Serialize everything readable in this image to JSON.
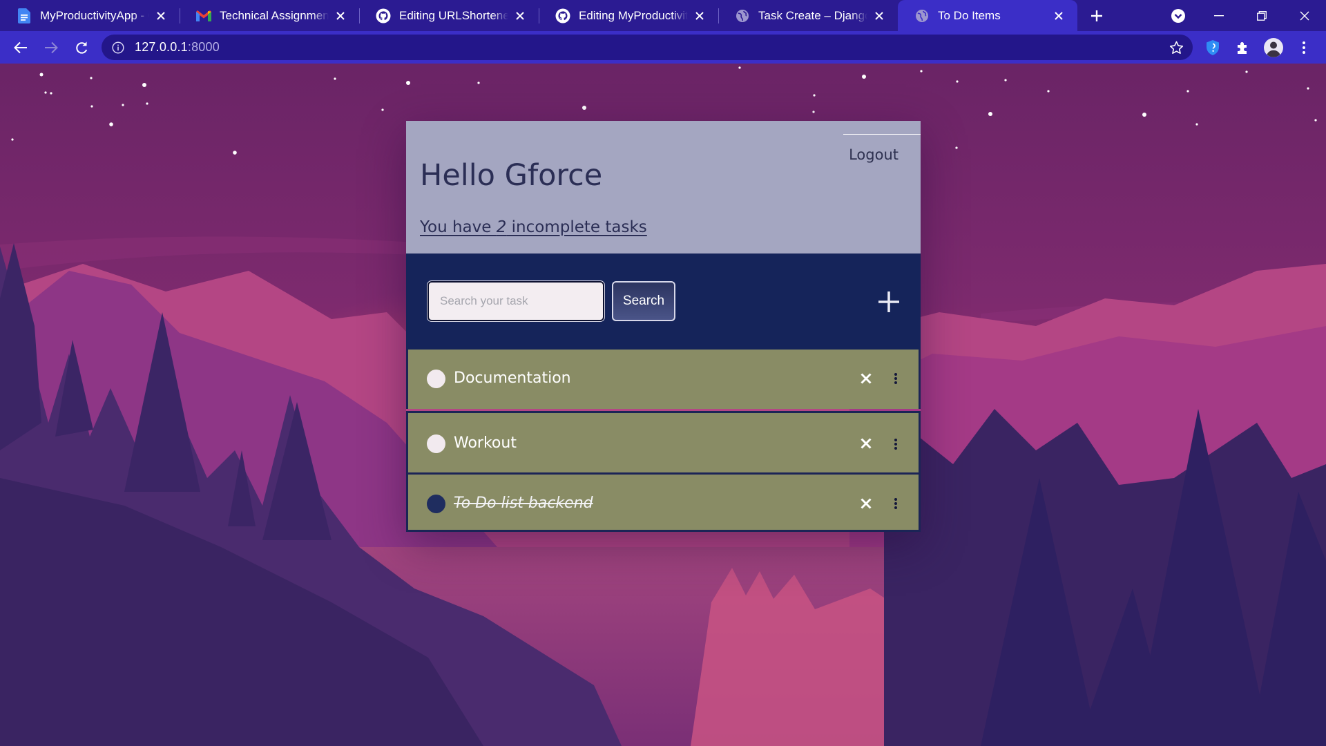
{
  "browser": {
    "tabs": [
      {
        "title": "MyProductivityApp - Go",
        "favicon": "google-docs-icon",
        "active": false
      },
      {
        "title": "Technical Assignments f",
        "favicon": "gmail-icon",
        "active": false
      },
      {
        "title": "Editing URLShortener/R",
        "favicon": "github-icon",
        "active": false
      },
      {
        "title": "Editing MyProductivityA",
        "favicon": "github-icon",
        "active": false
      },
      {
        "title": "Task Create – Django RE",
        "favicon": "globe-icon",
        "active": false
      },
      {
        "title": "To Do Items",
        "favicon": "globe-icon",
        "active": true
      }
    ],
    "url_host": "127.0.0.1",
    "url_port": ":8000",
    "accent": "#3b2ec7",
    "tabbar_color": "#2b1b92"
  },
  "page": {
    "greeting": "Hello Gforce",
    "logout_label": "Logout",
    "count_prefix": "You have ",
    "count_value": "2",
    "count_suffix": " incomplete tasks",
    "search_placeholder": "Search your task",
    "search_value": "",
    "search_button": "Search",
    "add_icon": "plus-icon",
    "colors": {
      "header_bg": "#a4a6c1",
      "bar_bg": "#15245a",
      "task_bg": "#898c65",
      "text_dark": "#2b2e55"
    }
  },
  "tasks": [
    {
      "title": "Documentation",
      "completed": false
    },
    {
      "title": "Workout",
      "completed": false
    },
    {
      "title": "To Do list backend",
      "completed": true
    }
  ]
}
